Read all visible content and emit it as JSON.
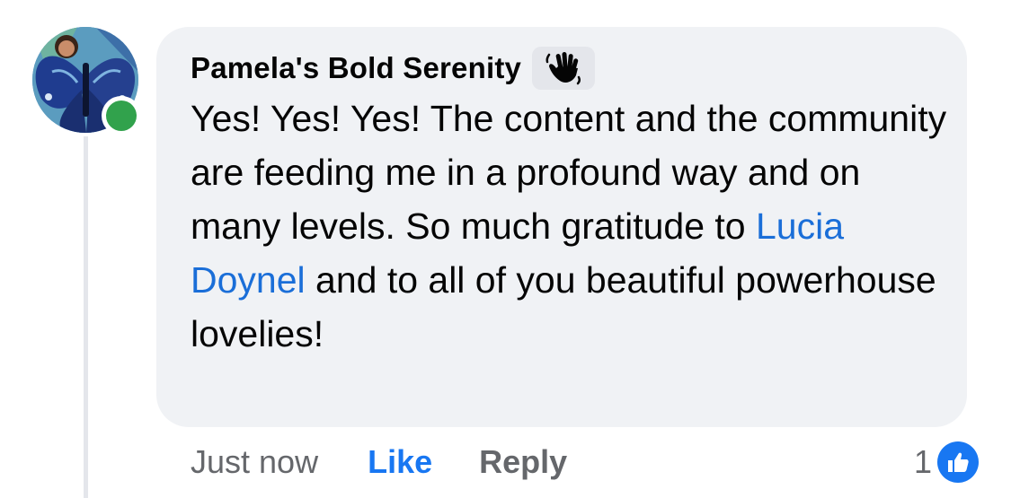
{
  "comment": {
    "author": "Pamela's Bold Serenity",
    "author_badge_icon": "waving-hand-icon",
    "online": true,
    "text_before_mention": "Yes! Yes! Yes! The content and the community are feeding me in a profound way and on many levels. So much gratitude to ",
    "mention": "Lucia Doynel",
    "text_after_mention": " and to all of you beautiful powerhouse lovelies!",
    "timestamp": "Just now",
    "like_label": "Like",
    "reply_label": "Reply",
    "reaction_count": "1",
    "reaction_icon": "thumbs-up-icon"
  },
  "colors": {
    "bubble": "#f0f2f5",
    "mention": "#1a6ed8",
    "like_active": "#1877f2",
    "muted": "#65676b",
    "online": "#31a24c"
  }
}
